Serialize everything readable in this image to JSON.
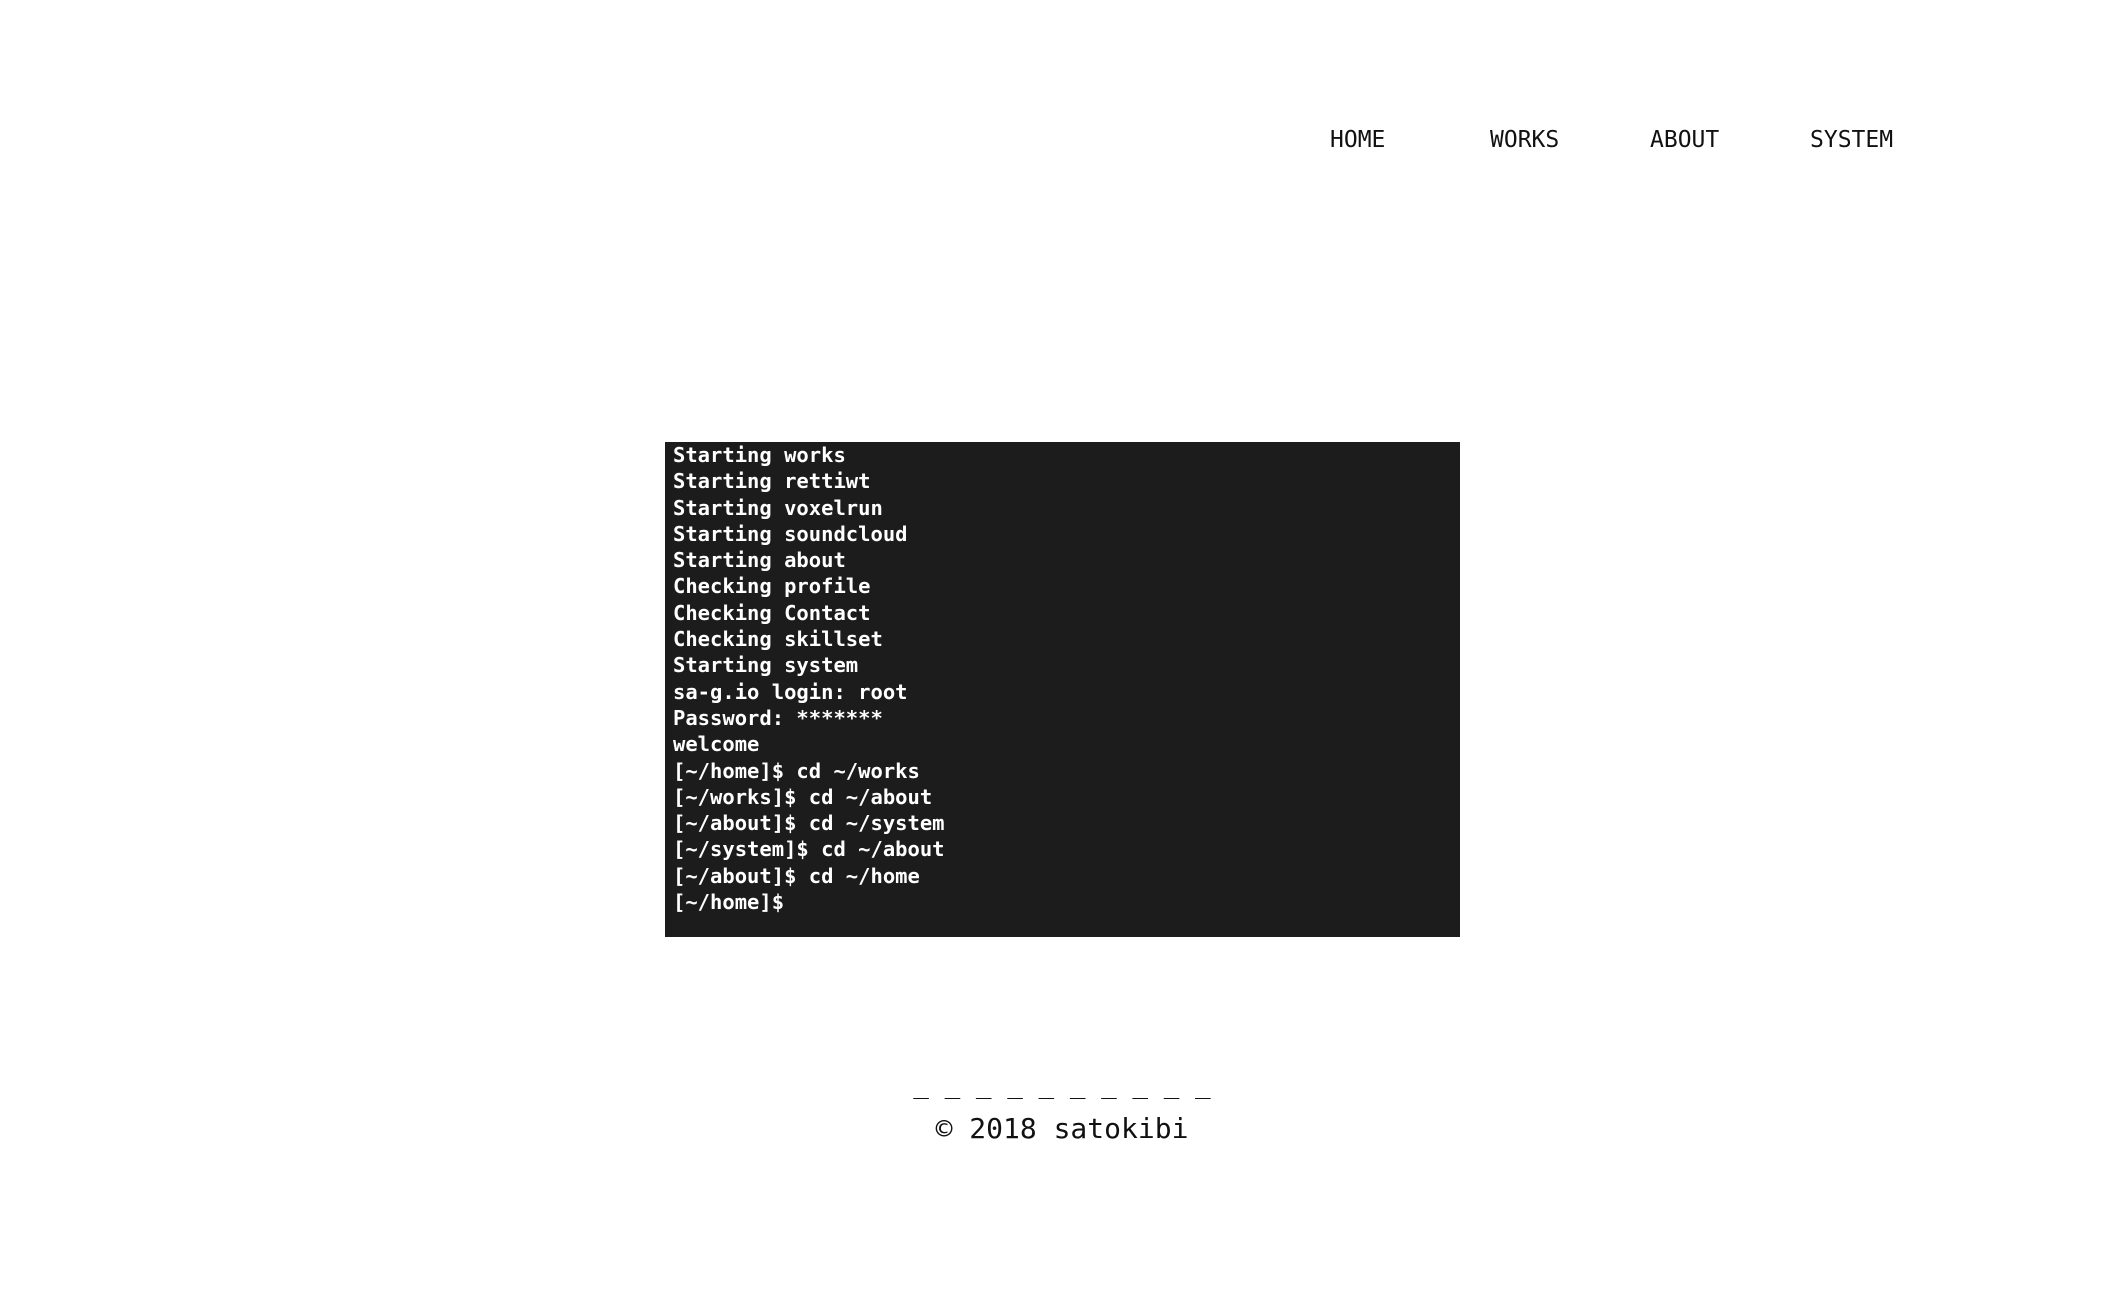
{
  "nav": {
    "items": [
      {
        "label": "HOME"
      },
      {
        "label": "WORKS"
      },
      {
        "label": "ABOUT"
      },
      {
        "label": "SYSTEM"
      }
    ]
  },
  "terminal": {
    "lines": [
      "Starting works",
      "Starting rettiwt",
      "Starting voxelrun",
      "Starting soundcloud",
      "Starting about",
      "Checking profile",
      "Checking Contact",
      "Checking skillset",
      "Starting system",
      "sa-g.io login: root",
      "Password: *******",
      "welcome",
      "[~/home]$ cd ~/works",
      "[~/works]$ cd ~/about",
      "[~/about]$ cd ~/system",
      "[~/system]$ cd ~/about",
      "[~/about]$ cd ~/home",
      "[~/home]$"
    ],
    "background_color": "#1c1c1c",
    "text_color": "#ffffff"
  },
  "footer": {
    "divider": "_ _ _ _ _ _ _ _ _ _",
    "copyright": "© 2018 satokibi"
  }
}
